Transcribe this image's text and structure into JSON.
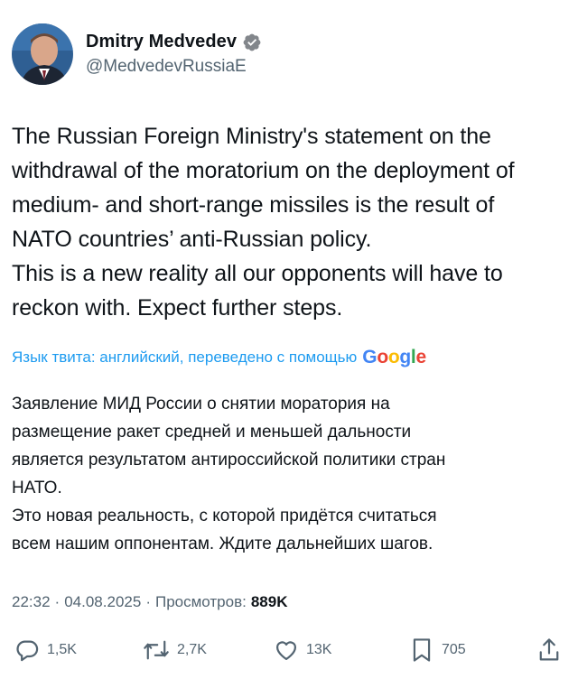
{
  "author": {
    "name": "Dmitry Medvedev",
    "handle": "@MedvedevRussiaE"
  },
  "tweet": {
    "lines": [
      "The Russian Foreign Ministry's statement on the",
      "withdrawal of the moratorium on the deployment of",
      "medium- and short-range missiles is the result of",
      "NATO countries’ anti-Russian policy.",
      "This is a new reality all our opponents will have to",
      "reckon with. Expect further steps."
    ]
  },
  "translation": {
    "label": "Язык твита: английский, переведено с помощью",
    "provider": "Google",
    "lines": [
      "Заявление МИД России о снятии моратория на",
      "размещение ракет средней и меньшей дальности",
      "является результатом антироссийской политики стран",
      "НАТО.",
      "Это новая реальность, с которой придётся считаться",
      "всем нашим оппонентам. Ждите дальнейших шагов."
    ]
  },
  "meta": {
    "time": "22:32",
    "separator": "·",
    "date": "04.08.2025",
    "views_label": "Просмотров:",
    "views_count": "889K"
  },
  "actions": {
    "replies": "1,5K",
    "reposts": "2,7K",
    "likes": "13K",
    "bookmarks": "705"
  },
  "icons": {
    "verified": "verified-badge-icon",
    "reply": "reply-icon",
    "repost": "repost-icon",
    "like": "heart-icon",
    "bookmark": "bookmark-icon",
    "share": "share-icon"
  },
  "colors": {
    "link_blue": "#1d9bf0",
    "secondary_text": "#536471",
    "primary_text": "#0f1419"
  }
}
